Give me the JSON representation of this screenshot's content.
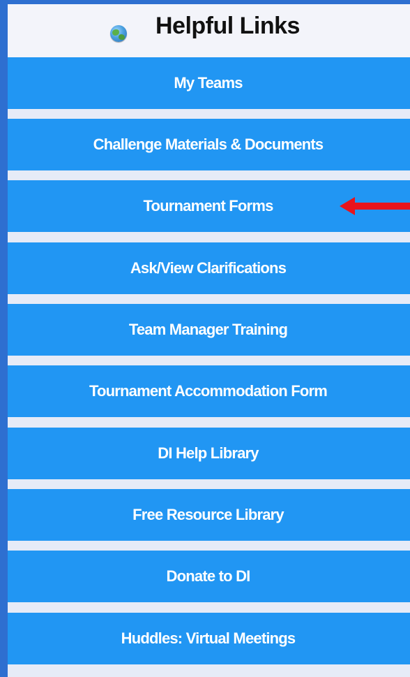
{
  "header": {
    "title": "Helpful Links",
    "icon": "globe-icon"
  },
  "links": [
    {
      "label": "My Teams"
    },
    {
      "label": "Challenge Materials & Documents"
    },
    {
      "label": "Tournament Forms",
      "highlighted": true
    },
    {
      "label": "Ask/View Clarifications"
    },
    {
      "label": "Team Manager Training"
    },
    {
      "label": "Tournament Accommodation Form"
    },
    {
      "label": "DI Help Library"
    },
    {
      "label": "Free Resource Library"
    },
    {
      "label": "Donate to DI"
    },
    {
      "label": "Huddles: Virtual Meetings"
    }
  ],
  "annotation": {
    "arrow_icon": "red-arrow-left-icon",
    "arrow_color": "#e8141c"
  },
  "colors": {
    "button_bg": "#2196f3",
    "panel_border": "#2e6fd0",
    "panel_bg": "#e6ebf7",
    "header_bg": "#f3f4fa"
  }
}
